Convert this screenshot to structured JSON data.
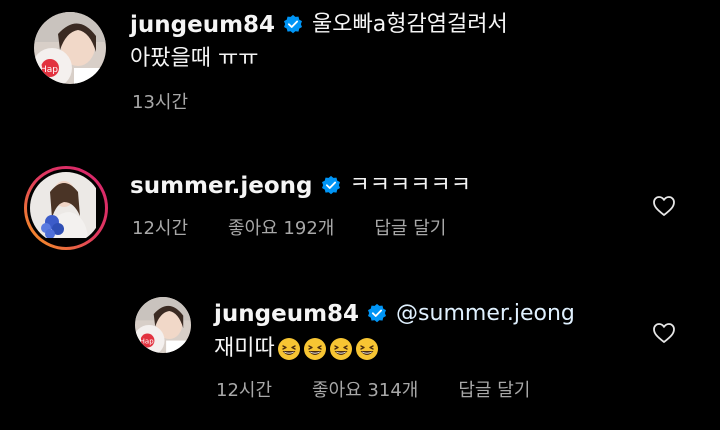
{
  "comments": [
    {
      "username": "jungeum84",
      "text_line1": "울오빠a형감염걸려서",
      "text_line2": "아팠을때 ㅠㅠ",
      "time": "13시간"
    },
    {
      "username": "summer.jeong",
      "text_line1": "ㅋㅋㅋㅋㅋㅋ",
      "time": "12시간",
      "likes": "좋아요 192개",
      "reply_label": "답글 달기"
    },
    {
      "username": "jungeum84",
      "mention": "@summer.jeong",
      "text_line2": "재미따",
      "emoji_count": 4,
      "time": "12시간",
      "likes": "좋아요 314개",
      "reply_label": "답글 달기"
    }
  ],
  "icons": {
    "verified": "verified-badge-icon",
    "like": "heart-outline-icon",
    "emoji": "grinning-squinting-face-emoji"
  },
  "colors": {
    "background": "#000000",
    "text": "#f5f5f5",
    "meta": "#a8a8a8",
    "verified": "#0095f6",
    "story_ring_start": "#f9a21b",
    "story_ring_end": "#d7226f"
  }
}
